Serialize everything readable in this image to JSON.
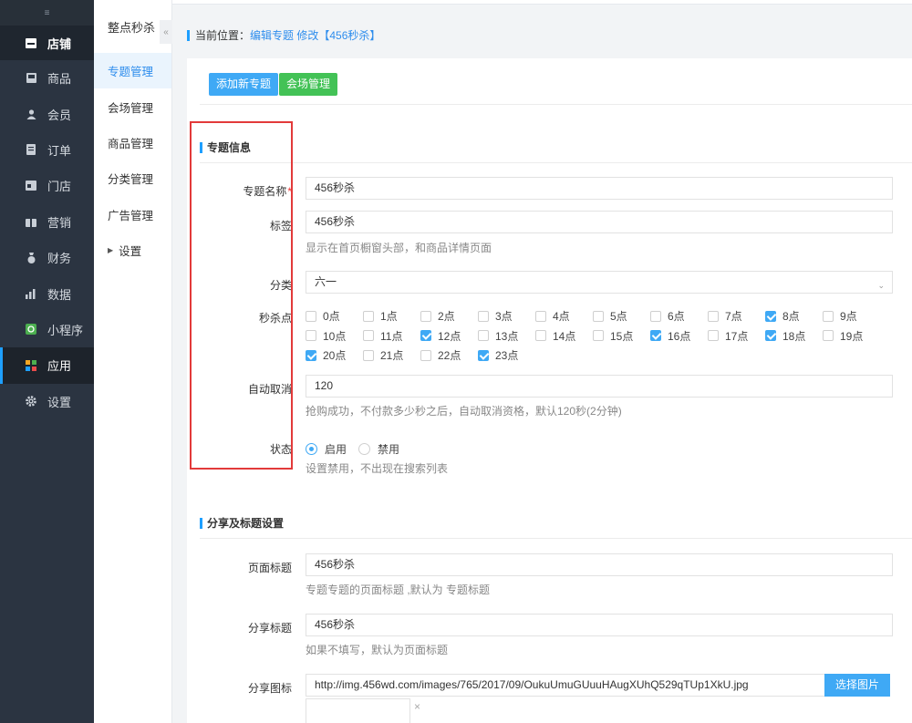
{
  "sidebar": {
    "toggle": "≡",
    "items": [
      {
        "label": "店铺",
        "icon": "store-icon"
      },
      {
        "label": "商品",
        "icon": "goods-icon"
      },
      {
        "label": "会员",
        "icon": "member-icon"
      },
      {
        "label": "订单",
        "icon": "order-icon"
      },
      {
        "label": "门店",
        "icon": "shop-icon"
      },
      {
        "label": "营销",
        "icon": "marketing-icon"
      },
      {
        "label": "财务",
        "icon": "finance-icon"
      },
      {
        "label": "数据",
        "icon": "data-icon"
      },
      {
        "label": "小程序",
        "icon": "miniprogram-icon"
      },
      {
        "label": "应用",
        "icon": "apps-icon"
      },
      {
        "label": "设置",
        "icon": "gear-icon"
      }
    ]
  },
  "subbar": {
    "title": "整点秒杀",
    "collapse": "«",
    "items": [
      "专题管理",
      "会场管理",
      "商品管理",
      "分类管理",
      "广告管理",
      "设置"
    ]
  },
  "breadcrumb": {
    "prefix": "当前位置：",
    "link": "编辑专题 修改【456秒杀】"
  },
  "buttons": {
    "add": "添加新专题",
    "venue": "会场管理"
  },
  "sections": {
    "info": "专题信息",
    "share": "分享及标题设置"
  },
  "form": {
    "name_label": "专题名称",
    "name_req": "*",
    "name_value": "456秒杀",
    "tag_label": "标签",
    "tag_value": "456秒杀",
    "tag_hint": "显示在首页橱窗头部，和商品详情页面",
    "category_label": "分类",
    "category_value": "六一",
    "points_label": "秒杀点",
    "cancel_label": "自动取消",
    "cancel_value": "120",
    "cancel_hint": "抢购成功，不付款多少秒之后，自动取消资格，默认120秒(2分钟)",
    "status_label": "状态",
    "status_on": "启用",
    "status_off": "禁用",
    "status_hint": "设置禁用，不出现在搜索列表",
    "page_title_label": "页面标题",
    "page_title_value": "456秒杀",
    "page_title_hint": "专题专题的页面标题 ,默认为 专题标题",
    "share_title_label": "分享标题",
    "share_title_value": "456秒杀",
    "share_title_hint": "如果不填写，默认为页面标题",
    "share_icon_label": "分享图标",
    "share_icon_value": "http://img.456wd.com/images/765/2017/09/OukuUmuGUuuHAugXUhQ529qTUp1XkU.jpg",
    "pick_image": "选择图片",
    "remove": "×"
  },
  "hours": [
    {
      "label": "0点",
      "checked": false
    },
    {
      "label": "1点",
      "checked": false
    },
    {
      "label": "2点",
      "checked": false
    },
    {
      "label": "3点",
      "checked": false
    },
    {
      "label": "4点",
      "checked": false
    },
    {
      "label": "5点",
      "checked": false
    },
    {
      "label": "6点",
      "checked": false
    },
    {
      "label": "7点",
      "checked": false
    },
    {
      "label": "8点",
      "checked": true
    },
    {
      "label": "9点",
      "checked": false
    },
    {
      "label": "10点",
      "checked": false
    },
    {
      "label": "11点",
      "checked": false
    },
    {
      "label": "12点",
      "checked": true
    },
    {
      "label": "13点",
      "checked": false
    },
    {
      "label": "14点",
      "checked": false
    },
    {
      "label": "15点",
      "checked": false
    },
    {
      "label": "16点",
      "checked": true
    },
    {
      "label": "17点",
      "checked": false
    },
    {
      "label": "18点",
      "checked": true
    },
    {
      "label": "19点",
      "checked": false
    },
    {
      "label": "20点",
      "checked": true
    },
    {
      "label": "21点",
      "checked": false
    },
    {
      "label": "22点",
      "checked": false
    },
    {
      "label": "23点",
      "checked": true
    }
  ],
  "colors": {
    "accent": "#3fa9f5",
    "green": "#43c256",
    "highlight_box": "#e23a3a",
    "sidebar_bg": "#2b3441"
  }
}
